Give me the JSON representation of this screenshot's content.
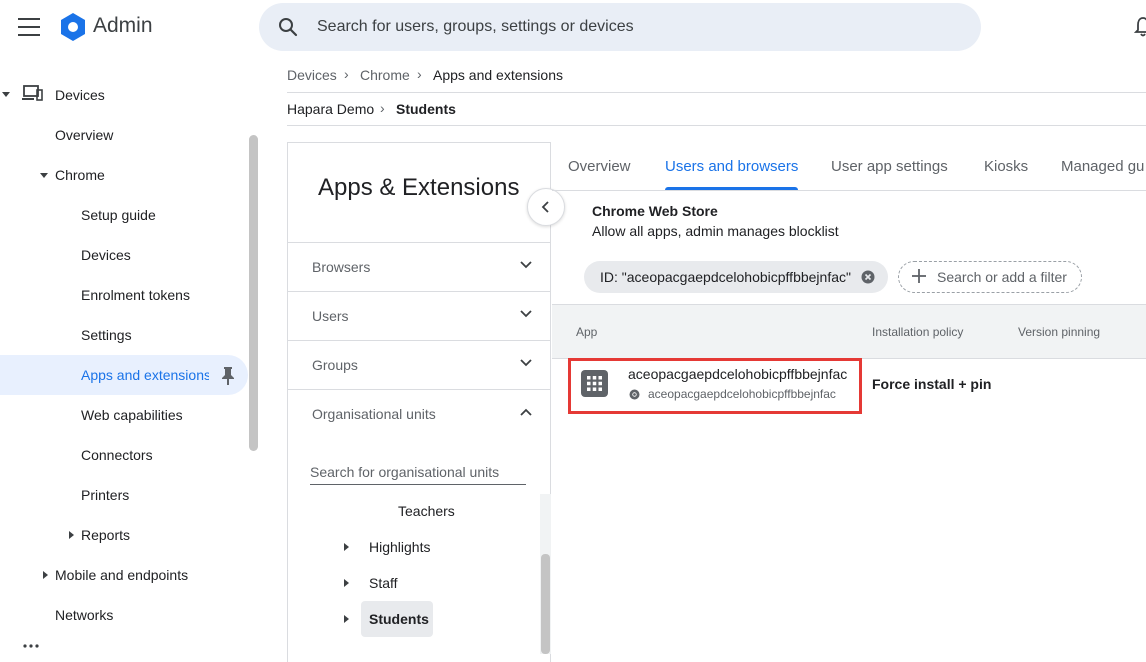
{
  "header": {
    "app_title": "Admin",
    "search_placeholder": "Search for users, groups, settings or devices"
  },
  "sidebar": {
    "items": [
      {
        "label": "Devices"
      },
      {
        "label": "Overview"
      },
      {
        "label": "Chrome"
      },
      {
        "label": "Setup guide"
      },
      {
        "label": "Devices"
      },
      {
        "label": "Enrolment tokens"
      },
      {
        "label": "Settings"
      },
      {
        "label": "Apps and extensions"
      },
      {
        "label": "Web capabilities"
      },
      {
        "label": "Connectors"
      },
      {
        "label": "Printers"
      },
      {
        "label": "Reports"
      },
      {
        "label": "Mobile and endpoints"
      },
      {
        "label": "Networks"
      }
    ],
    "active_index": 7
  },
  "breadcrumb": {
    "path": [
      "Devices",
      "Chrome",
      "Apps and extensions"
    ],
    "org": [
      "Hapara Demo",
      "Students"
    ]
  },
  "panel": {
    "title": "Apps & Extensions",
    "sections": [
      "Browsers",
      "Users",
      "Groups",
      "Organisational units"
    ],
    "ou_search_placeholder": "Search for organisational units",
    "tree": {
      "root": "Teachers",
      "children": [
        "Highlights",
        "Staff",
        "Students"
      ],
      "selected": "Students"
    }
  },
  "tabs": {
    "items": [
      "Overview",
      "Users and browsers",
      "User app settings",
      "Kiosks",
      "Managed gu"
    ],
    "active_index": 1
  },
  "store": {
    "title": "Chrome Web Store",
    "description": "Allow all apps, admin manages blocklist"
  },
  "filter": {
    "chip_label": "ID: \"aceopacgaepdcelohobicpffbbejnfac\"",
    "placeholder": "Search or add a filter"
  },
  "table": {
    "headers": [
      "App",
      "Installation policy",
      "Version pinning"
    ],
    "rows": [
      {
        "app_name": "aceopacgaepdcelohobicpffbbejnfac",
        "app_id": "aceopacgaepdcelohobicpffbbejnfac",
        "policy": "Force install + pin"
      }
    ]
  },
  "colors": {
    "accent": "#1a73e8",
    "active_nav_bg": "#e8f0fe",
    "highlight_border": "#e53935"
  }
}
